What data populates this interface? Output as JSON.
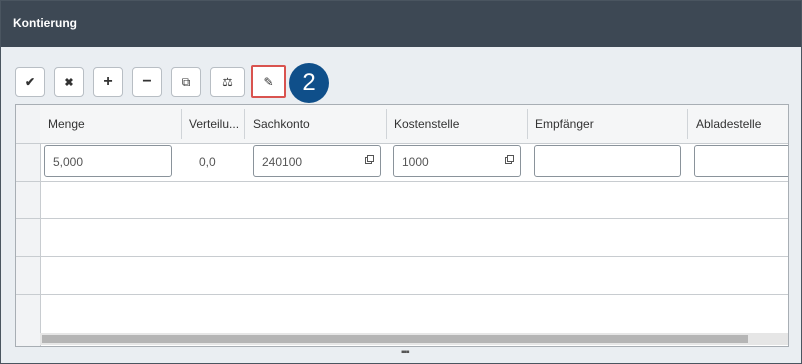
{
  "window": {
    "title": "Kontierung"
  },
  "toolbar": {
    "buttons": [
      {
        "name": "confirm-button",
        "glyph": "✔"
      },
      {
        "name": "delete-button",
        "glyph": "✖"
      },
      {
        "name": "add-row-button",
        "glyph": "+"
      },
      {
        "name": "remove-row-button",
        "glyph": "−"
      },
      {
        "name": "copy-button",
        "glyph": "⧉"
      },
      {
        "name": "balance-button",
        "glyph": "⚖"
      },
      {
        "name": "edit-button",
        "glyph": "✎"
      }
    ]
  },
  "callout": {
    "number": "2"
  },
  "table": {
    "columns": [
      "Menge",
      "Verteilu...",
      "Sachkonto",
      "Kostenstelle",
      "Empfänger",
      "Abladestelle"
    ],
    "rows": [
      {
        "menge": "5,000",
        "verteilung": "0,0",
        "sachkonto": "240100",
        "kostenstelle": "1000",
        "empfaenger": "",
        "abladestelle": ""
      }
    ]
  }
}
